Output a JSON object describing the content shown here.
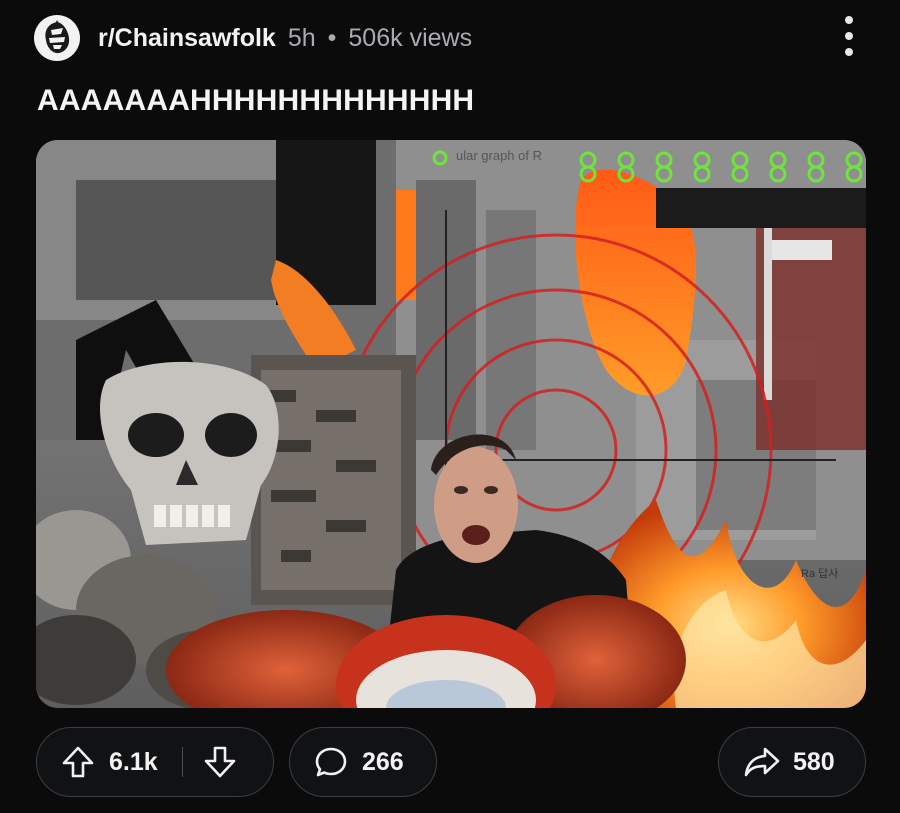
{
  "post": {
    "subreddit": "r/Chainsawfolk",
    "time": "5h",
    "separator": "•",
    "views": "506k views",
    "title": "AAAAAAAHHHHHHHHHHHHH"
  },
  "media": {
    "overlay_text": "ular graph of R",
    "corner_text": "Ra 답사"
  },
  "actions": {
    "upvotes": "6.1k",
    "comments": "266",
    "shares": "580"
  },
  "icons": {
    "avatar": "chainsaw-man-avatar-icon",
    "more": "more-vertical-icon",
    "upvote": "arrow-up-icon",
    "downvote": "arrow-down-icon",
    "comment": "comment-bubble-icon",
    "share": "share-arrow-icon"
  },
  "colors": {
    "background": "#0b0b0c",
    "pill_border": "#3b3e44",
    "meta_text": "#a8abb0"
  }
}
